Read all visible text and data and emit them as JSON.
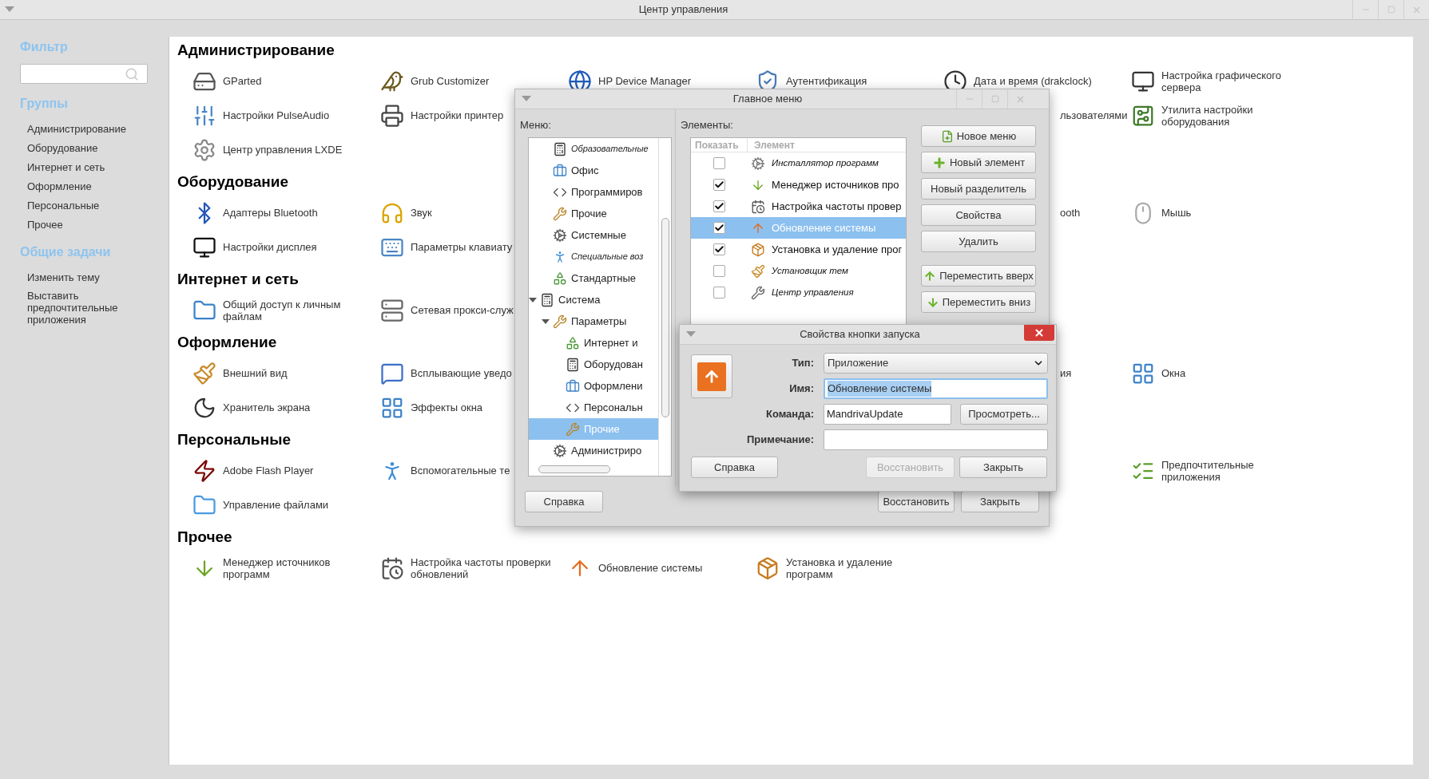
{
  "window": {
    "title": "Центр управления"
  },
  "sidebar": {
    "filter_heading": "Фильтр",
    "groups_heading": "Группы",
    "groups": [
      {
        "label": "Администрирование"
      },
      {
        "label": "Оборудование"
      },
      {
        "label": "Интернет и сеть"
      },
      {
        "label": "Оформление"
      },
      {
        "label": "Персональные"
      },
      {
        "label": "Прочее"
      }
    ],
    "tasks_heading": "Общие задачи",
    "tasks": [
      {
        "label": "Изменить тему"
      },
      {
        "label": "Выставить предпочтительные приложения"
      }
    ]
  },
  "sections": [
    {
      "title": "Администрирование",
      "rows": [
        [
          {
            "kind": "full",
            "label": "GParted"
          },
          {
            "kind": "full",
            "label": "Grub Customizer"
          },
          {
            "kind": "full",
            "label": "HP Device Manager"
          },
          {
            "kind": "full",
            "label": "Аутентификация"
          },
          {
            "kind": "full",
            "label": "Дата и время (drakclock)"
          },
          {
            "kind": "full",
            "label": "Настройка графического сервера"
          }
        ],
        [
          {
            "kind": "full",
            "label": "Настройки PulseAudio"
          },
          {
            "kind": "cut_right",
            "label": "Настройки принтер"
          },
          "",
          "",
          {
            "kind": "cut_left",
            "label": "льзователями"
          },
          {
            "kind": "full",
            "label": "Утилита настройки оборудования"
          }
        ],
        [
          {
            "kind": "full",
            "label": "Центр управления LXDE"
          }
        ]
      ]
    },
    {
      "title": "Оборудование",
      "rows": [
        [
          {
            "kind": "full",
            "label": "Адаптеры Bluetooth"
          },
          {
            "kind": "full",
            "label": "Звук"
          },
          "",
          "",
          {
            "kind": "cut_left",
            "label": "ooth"
          },
          {
            "kind": "full",
            "label": "Мышь"
          }
        ],
        [
          {
            "kind": "full",
            "label": "Настройки дисплея"
          },
          {
            "kind": "cut_right",
            "label": "Параметры клавиату"
          }
        ]
      ]
    },
    {
      "title": "Интернет и сеть",
      "rows": [
        [
          {
            "kind": "full",
            "label": "Общий доступ к личным файлам"
          },
          {
            "kind": "cut_right",
            "label": "Сетевая прокси-служ"
          }
        ]
      ]
    },
    {
      "title": "Оформление",
      "rows": [
        [
          {
            "kind": "full",
            "label": "Внешний вид"
          },
          {
            "kind": "cut_right",
            "label": "Всплывающие уведо"
          },
          "",
          "",
          {
            "kind": "cut_left",
            "label": "ия"
          },
          {
            "kind": "full",
            "label": "Окна"
          }
        ],
        [
          {
            "kind": "full",
            "label": "Хранитель экрана"
          },
          {
            "kind": "full",
            "label": "Эффекты окна"
          }
        ]
      ]
    },
    {
      "title": "Персональные",
      "rows": [
        [
          {
            "kind": "full",
            "label": "Adobe Flash Player"
          },
          {
            "kind": "cut_right",
            "label": "Вспомогательные те"
          },
          "",
          "",
          "",
          {
            "kind": "full",
            "label": "Предпочтительные приложения"
          }
        ],
        [
          {
            "kind": "full",
            "label": "Управление файлами"
          }
        ]
      ]
    },
    {
      "title": "Прочее",
      "rows": [
        [
          {
            "kind": "full",
            "label": "Менеджер источников программ"
          },
          {
            "kind": "full",
            "label": "Настройка частоты проверки обновлений"
          },
          {
            "kind": "full",
            "label": "Обновление системы"
          },
          {
            "kind": "full",
            "label": "Установка и удаление программ"
          }
        ]
      ]
    }
  ],
  "menu_editor": {
    "title": "Главное меню",
    "menu_label": "Меню:",
    "tree": {
      "cut_group": [
        {
          "label": "Образовательные",
          "hidden": true,
          "selected": false
        },
        {
          "label": "Офис",
          "hidden": false,
          "selected": false
        },
        {
          "label": "Программиров",
          "hidden": false,
          "selected": false
        },
        {
          "label": "Прочие",
          "hidden": false,
          "selected": false
        },
        {
          "label": "Системные",
          "hidden": false,
          "selected": false
        },
        {
          "label": "Специальные воз",
          "hidden": true,
          "selected": false
        },
        {
          "label": "Стандартные",
          "hidden": false,
          "selected": false
        }
      ],
      "items": [
        {
          "label": "Система",
          "hidden": false,
          "selected": false,
          "expanded": true,
          "children": [
            {
              "label": "Параметры",
              "hidden": false,
              "selected": false,
              "expanded": true,
              "children": [
                {
                  "label": "Интернет и",
                  "hidden": false,
                  "selected": false
                },
                {
                  "label": "Оборудован",
                  "hidden": false,
                  "selected": false
                },
                {
                  "label": "Оформлени",
                  "hidden": false,
                  "selected": false
                },
                {
                  "label": "Персональн",
                  "hidden": false,
                  "selected": false
                },
                {
                  "label": "Прочие",
                  "hidden": false,
                  "selected": true
                }
              ]
            },
            {
              "label": "Администриро",
              "hidden": false,
              "selected": false
            }
          ]
        }
      ]
    },
    "elements_label": "Элементы:",
    "table": {
      "columns": [
        "Показать",
        "Элемент"
      ],
      "rows": [
        {
          "show": false,
          "name": "Инсталлятор программ",
          "selected": false
        },
        {
          "show": true,
          "name": "Менеджер источников про",
          "selected": false
        },
        {
          "show": true,
          "name": "Настройка частоты провер",
          "selected": false
        },
        {
          "show": true,
          "name": "Обновление системы",
          "selected": true
        },
        {
          "show": true,
          "name": "Установка и удаление прог",
          "selected": false
        },
        {
          "show": false,
          "name": "Установщик тем",
          "selected": false
        },
        {
          "show": false,
          "name": "Центр управления",
          "selected": false
        }
      ]
    },
    "buttons": [
      {
        "kind": "new_menu",
        "label": "Новое меню"
      },
      {
        "kind": "new_item",
        "label": "Новый элемент"
      },
      {
        "kind": "plain",
        "label": "Новый разделитель"
      },
      {
        "kind": "plain",
        "label": "Свойства"
      },
      {
        "kind": "plain",
        "label": "Удалить"
      },
      {
        "kind": "move_up",
        "label": "Переместить вверх"
      },
      {
        "kind": "move_down",
        "label": "Переместить вниз"
      }
    ],
    "help_button": {
      "label": "Справка"
    },
    "revert_button": {
      "label": "Восстановить",
      "disabled": false
    },
    "close_button": {
      "label": "Закрыть"
    }
  },
  "launcher_properties": {
    "title": "Свойства кнопки запуска",
    "type": {
      "label": "Тип:",
      "value": "Приложение"
    },
    "name": {
      "label": "Имя:",
      "value": "Обновление системы",
      "focused": true
    },
    "command": {
      "label": "Команда:",
      "value": "MandrivaUpdate"
    },
    "browse_button": "Просмотреть...",
    "comment": {
      "label": "Примечание:"
    },
    "help_button": {
      "label": "Справка"
    },
    "revert_button": {
      "label": "Восстановить",
      "disabled": true
    },
    "close_button": {
      "label": "Закрыть"
    }
  }
}
